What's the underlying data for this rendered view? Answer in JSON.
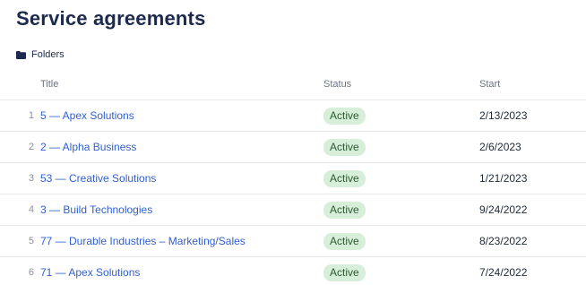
{
  "page": {
    "title": "Service agreements"
  },
  "folders": {
    "label": "Folders",
    "icon": "folder-icon"
  },
  "table": {
    "headers": {
      "title": "Title",
      "status": "Status",
      "start": "Start"
    },
    "rows": [
      {
        "num": "1",
        "title": "5 — Apex Solutions",
        "status": "Active",
        "start": "2/13/2023"
      },
      {
        "num": "2",
        "title": "2 — Alpha Business",
        "status": "Active",
        "start": "2/6/2023"
      },
      {
        "num": "3",
        "title": "53 — Creative Solutions",
        "status": "Active",
        "start": "1/21/2023"
      },
      {
        "num": "4",
        "title": "3 — Build Technologies",
        "status": "Active",
        "start": "9/24/2022"
      },
      {
        "num": "5",
        "title": "77 — Durable Industries – Marketing/Sales",
        "status": "Active",
        "start": "8/23/2022"
      },
      {
        "num": "6",
        "title": "71 — Apex Solutions",
        "status": "Active",
        "start": "7/24/2022"
      }
    ]
  },
  "colors": {
    "link": "#2f5fd0",
    "badge_bg": "#d7efd9",
    "badge_text": "#2b5b32",
    "heading": "#1c2a4d"
  }
}
